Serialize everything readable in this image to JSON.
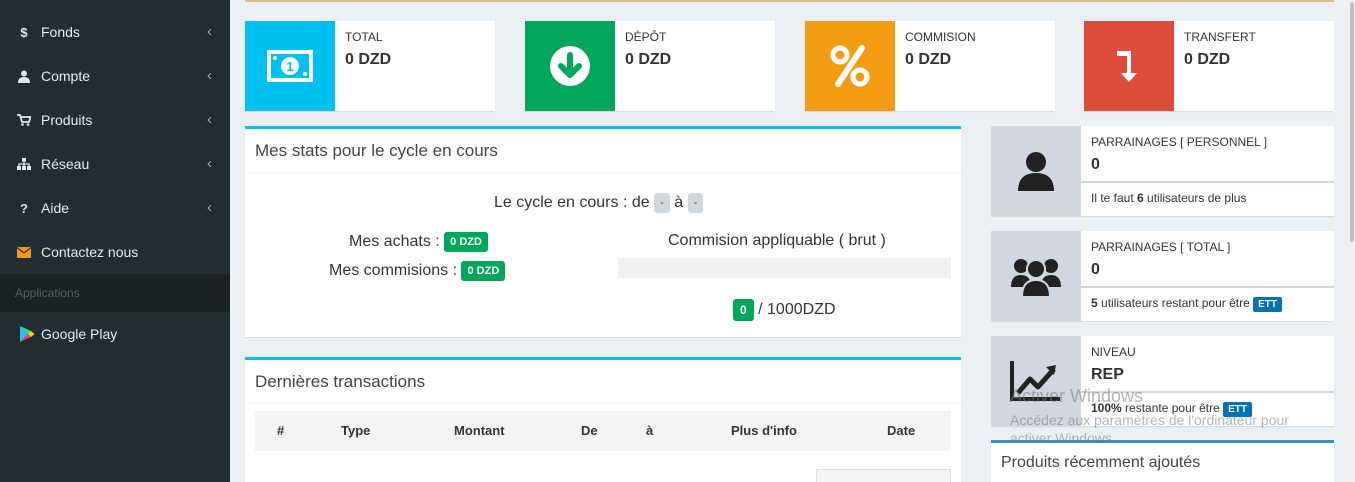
{
  "sidebar": {
    "items": [
      {
        "label": "Fonds",
        "icon": "dollar-icon",
        "glyph": "$"
      },
      {
        "label": "Compte",
        "icon": "user-icon",
        "glyph": ""
      },
      {
        "label": "Produits",
        "icon": "cart-icon",
        "glyph": ""
      },
      {
        "label": "Réseau",
        "icon": "sitemap-icon",
        "glyph": ""
      },
      {
        "label": "Aide",
        "icon": "question-icon",
        "glyph": "?"
      },
      {
        "label": "Contactez nous",
        "icon": "envelope-icon",
        "glyph": ""
      }
    ],
    "section_header": "Applications",
    "app_item": {
      "label": "Google Play",
      "icon": "google-play-icon"
    }
  },
  "info_boxes": [
    {
      "label": "TOTAL",
      "value": "0 DZD",
      "color": "#00c0ef",
      "icon": "money-icon"
    },
    {
      "label": "DÉPÔT",
      "value": "0 DZD",
      "color": "#00a65a",
      "icon": "arrow-down-circle-icon"
    },
    {
      "label": "COMMISION",
      "value": "0 DZD",
      "color": "#f39c12",
      "icon": "percent-icon"
    },
    {
      "label": "TRANSFERT",
      "value": "0 DZD",
      "color": "#dd4b39",
      "icon": "level-down-icon"
    }
  ],
  "stats": {
    "title": "Mes stats pour le cycle en cours",
    "cycle_label": "Le cycle en cours : de",
    "cycle_from": "-",
    "cycle_sep": "à",
    "cycle_to": "-",
    "achats_label": "Mes achats :",
    "achats_value": "0 DZD",
    "commisions_label": "Mes commisions :",
    "commisions_value": "0 DZD",
    "commision_applicable_label": "Commision appliquable ( brut )",
    "progress_fraction": 0,
    "progress_value": "0",
    "progress_total": "/ 1000DZD"
  },
  "transactions": {
    "title": "Dernières transactions",
    "columns": [
      "#",
      "Type",
      "Montant",
      "De",
      "à",
      "Plus d'info",
      "Date"
    ]
  },
  "side_boxes": [
    {
      "label": "PARRAINAGES [ PERSONNEL ]",
      "value": "0",
      "desc_pre": "Il te faut ",
      "desc_bold": "6",
      "desc_post": " utilisateurs de plus",
      "badge": "",
      "icon": "user-icon"
    },
    {
      "label": "PARRAINAGES [ TOTAL ]",
      "value": "0",
      "desc_pre": "",
      "desc_bold": "5",
      "desc_post": " utilisateurs restant pour être",
      "badge": "ETT",
      "icon": "users-icon"
    },
    {
      "label": "NIVEAU",
      "value": "REP",
      "desc_pre": "",
      "desc_bold": "100%",
      "desc_post": " restante pour être",
      "badge": "ETT",
      "icon": "line-chart-icon"
    }
  ],
  "recent_products": {
    "title": "Produits récemment ajoutés"
  },
  "watermark": {
    "line1": "Activer Windows",
    "line2": "Accédez aux paramètres de l'ordinateur pour",
    "line3": "activer Windows."
  }
}
